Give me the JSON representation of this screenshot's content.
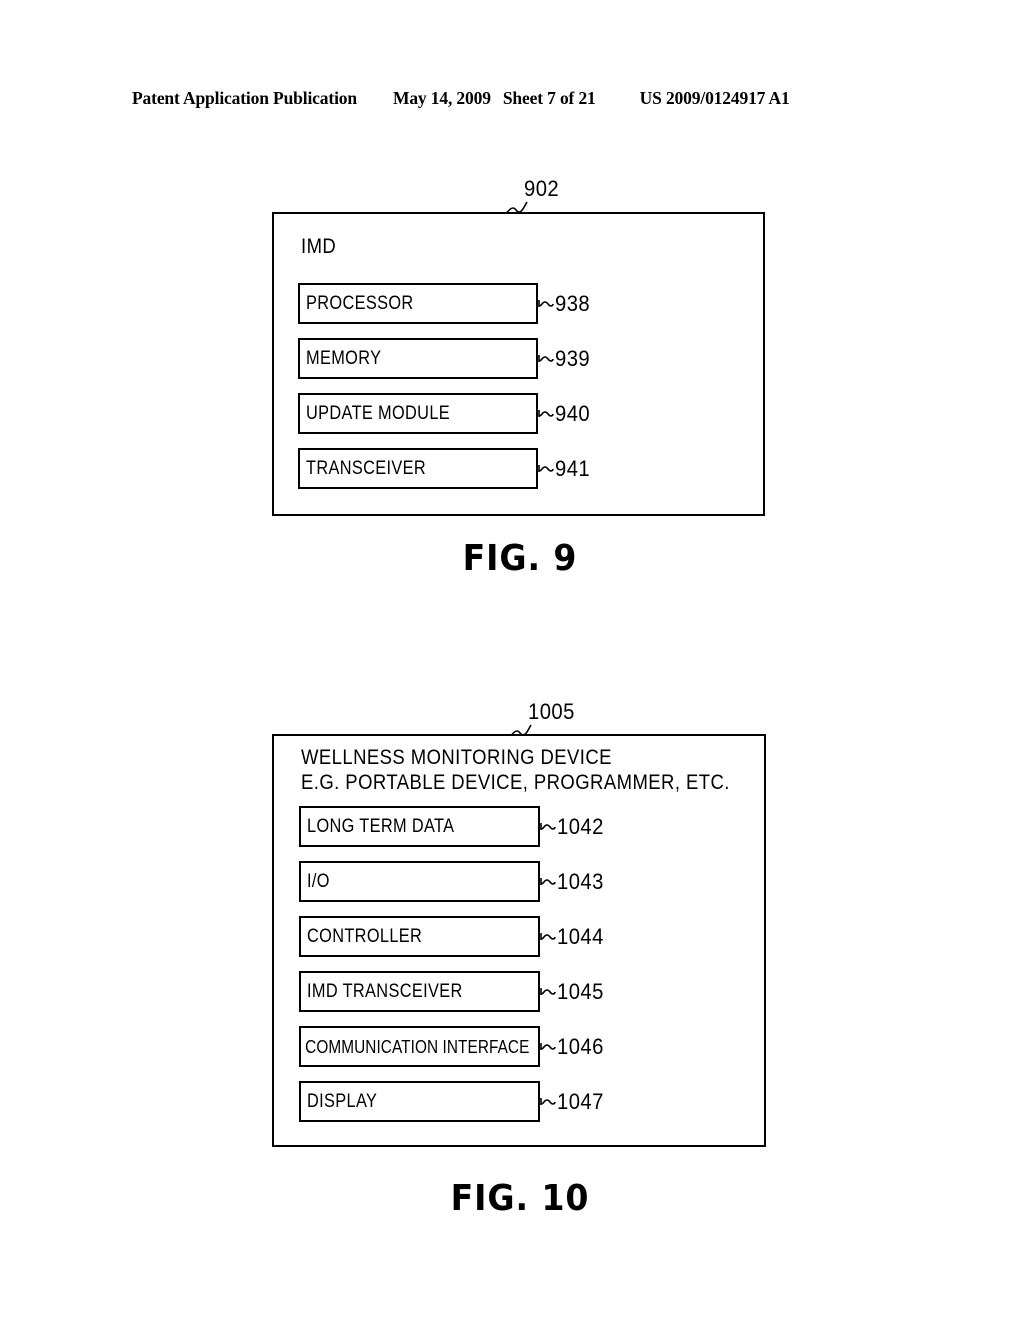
{
  "header": {
    "publication": "Patent Application Publication",
    "date": "May 14, 2009",
    "sheet": "Sheet 7 of 21",
    "patent_number": "US 2009/0124917 A1"
  },
  "figures": [
    {
      "caption": "FIG.  9",
      "callout": "902",
      "title": "IMD",
      "blocks": [
        {
          "label": "PROCESSOR",
          "ref": "938"
        },
        {
          "label": "MEMORY",
          "ref": "939"
        },
        {
          "label": "UPDATE  MODULE",
          "ref": "940"
        },
        {
          "label": "TRANSCEIVER",
          "ref": "941"
        }
      ]
    },
    {
      "caption": "FIG.  10",
      "callout": "1005",
      "title_line_1": "WELLNESS  MONITORING  DEVICE",
      "title_line_2": "E.G.  PORTABLE  DEVICE,  PROGRAMMER,  ETC.",
      "blocks": [
        {
          "label": "LONG  TERM  DATA",
          "ref": "1042"
        },
        {
          "label": "I/O",
          "ref": "1043"
        },
        {
          "label": "CONTROLLER",
          "ref": "1044"
        },
        {
          "label": "IMD  TRANSCEIVER",
          "ref": "1045"
        },
        {
          "label": "COMMUNICATION  INTERFACE",
          "ref": "1046"
        },
        {
          "label": "DISPLAY",
          "ref": "1047"
        }
      ]
    }
  ],
  "colors": {
    "ink": "#000000",
    "paper": "#ffffff"
  }
}
